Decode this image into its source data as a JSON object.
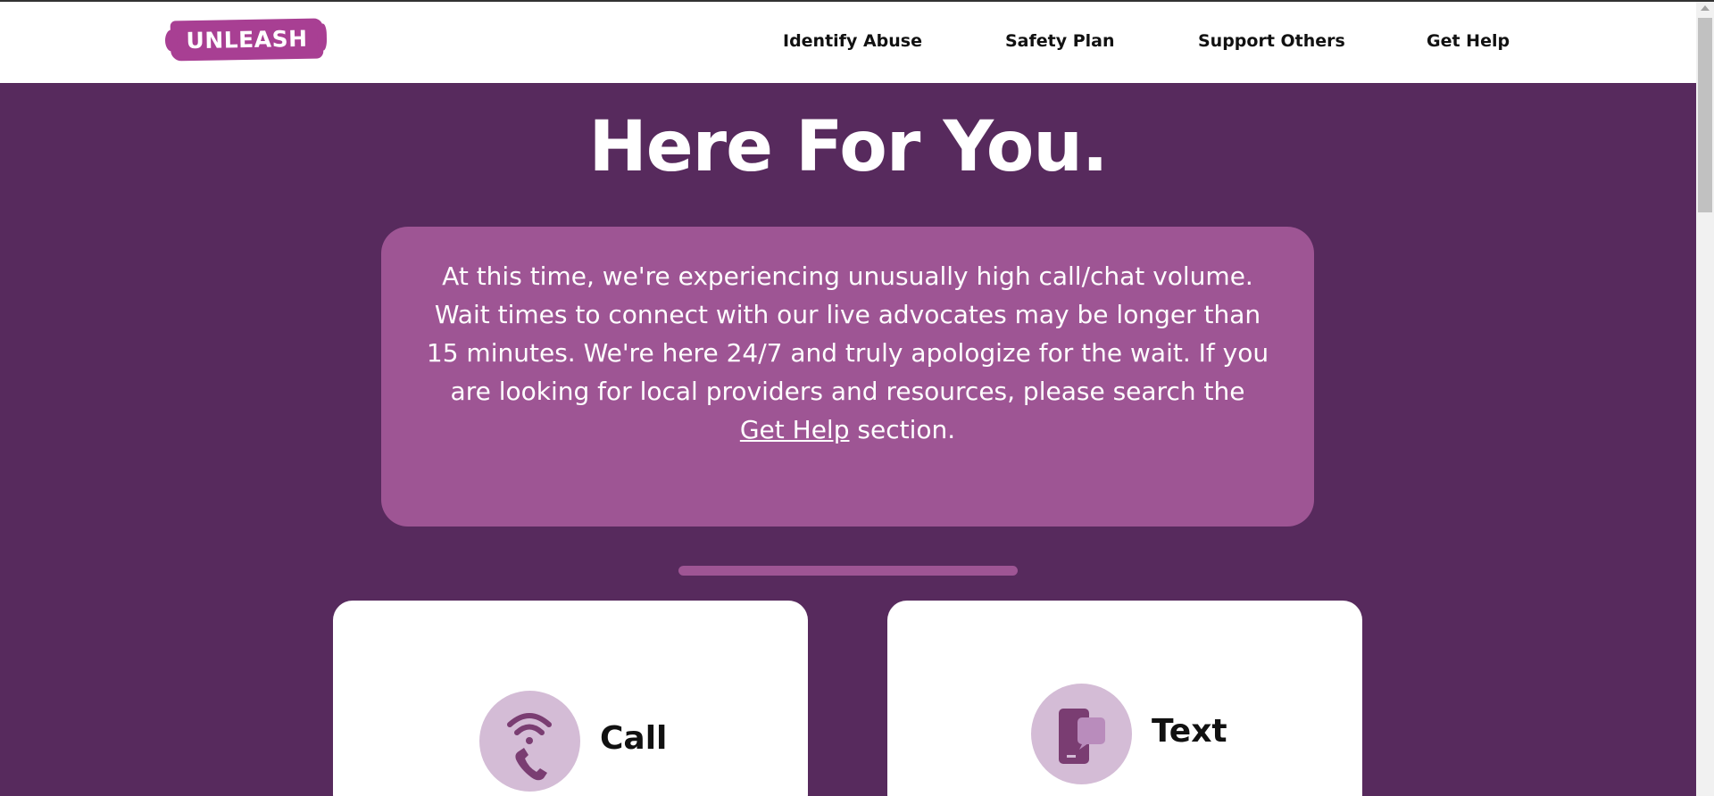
{
  "header": {
    "logo_text": "UNLEASH",
    "nav": [
      {
        "label": "Identify Abuse"
      },
      {
        "label": "Safety Plan"
      },
      {
        "label": "Support Others"
      },
      {
        "label": "Get Help"
      }
    ]
  },
  "hero": {
    "title": "Here For You.",
    "notice_text": "At this time, we're experiencing unusually high call/chat volume. Wait times to connect with our live advocates may be longer than 15 minutes. We're here 24/7 and truly apologize for the wait. If you are looking for local providers and resources, please search the",
    "notice_link": "Get Help",
    "notice_suffix": " section."
  },
  "cards": [
    {
      "title": "Call",
      "icon": "phone-icon"
    },
    {
      "title": "Text",
      "icon": "chat-phone-icon"
    }
  ],
  "colors": {
    "background": "#572a5d",
    "accent": "#a83f93",
    "notice_bg": "#9e5594",
    "icon_circle": "#d4bcd6",
    "icon_fill": "#7a3d72"
  }
}
